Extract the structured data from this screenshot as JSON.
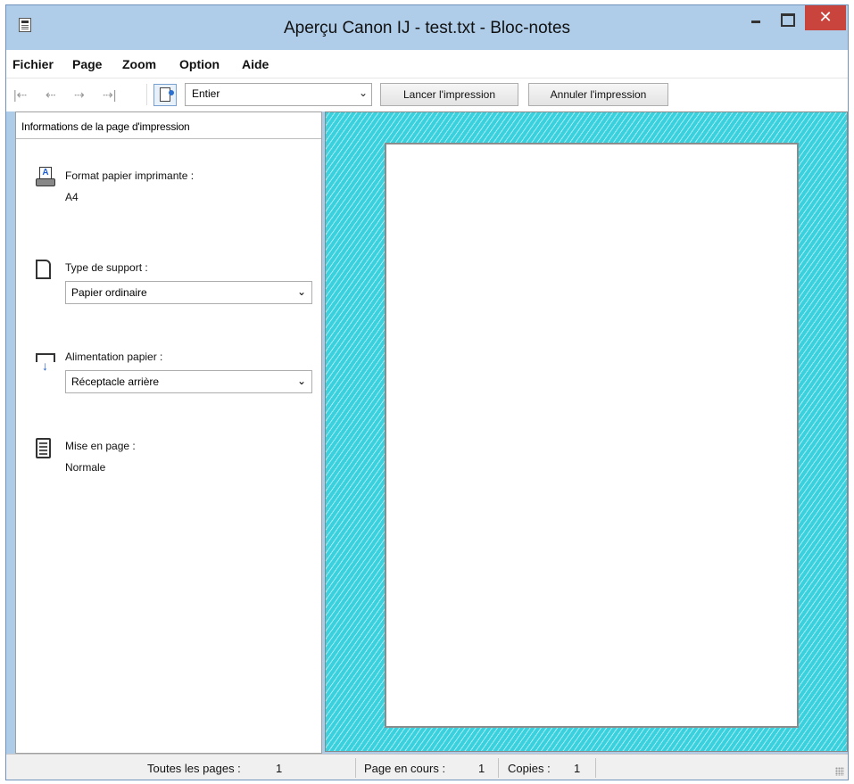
{
  "window": {
    "title": "Aperçu Canon IJ - test.txt - Bloc-notes",
    "close_glyph": "✕"
  },
  "menu": [
    "Fichier",
    "Page",
    "Zoom",
    "Option",
    "Aide"
  ],
  "toolbar": {
    "nav": [
      "|⇠",
      "⇠",
      "⇢",
      "⇢|"
    ],
    "zoom_value": "Entier",
    "print_button": "Lancer l'impression",
    "cancel_button": "Annuler l'impression"
  },
  "panel": {
    "header": "Informations de la page d'impression",
    "paper_size": {
      "label": "Format papier imprimante :",
      "value": "A4"
    },
    "media_type": {
      "label": "Type de support :",
      "value": "Papier ordinaire"
    },
    "paper_source": {
      "label": "Alimentation papier :",
      "value": "Réceptacle arrière"
    },
    "layout": {
      "label": "Mise en page :",
      "value": "Normale"
    }
  },
  "status": {
    "all_pages": "Toutes les pages :",
    "all_pages_value": "1",
    "current_page": "Page en cours :",
    "current_page_value": "1",
    "copies": "Copies :",
    "copies_value": "1"
  },
  "colors": {
    "titlebar": "#afcde9",
    "close_button": "#c8443d",
    "preview_background": "#3ad1df"
  },
  "icons": [
    "app-icon",
    "first-page-icon",
    "previous-page-icon",
    "next-page-icon",
    "last-page-icon",
    "page-icon",
    "printer-paper-icon",
    "paper-icon",
    "paper-tray-icon",
    "layout-icon",
    "chevron-down-icon",
    "resize-grip-icon"
  ]
}
